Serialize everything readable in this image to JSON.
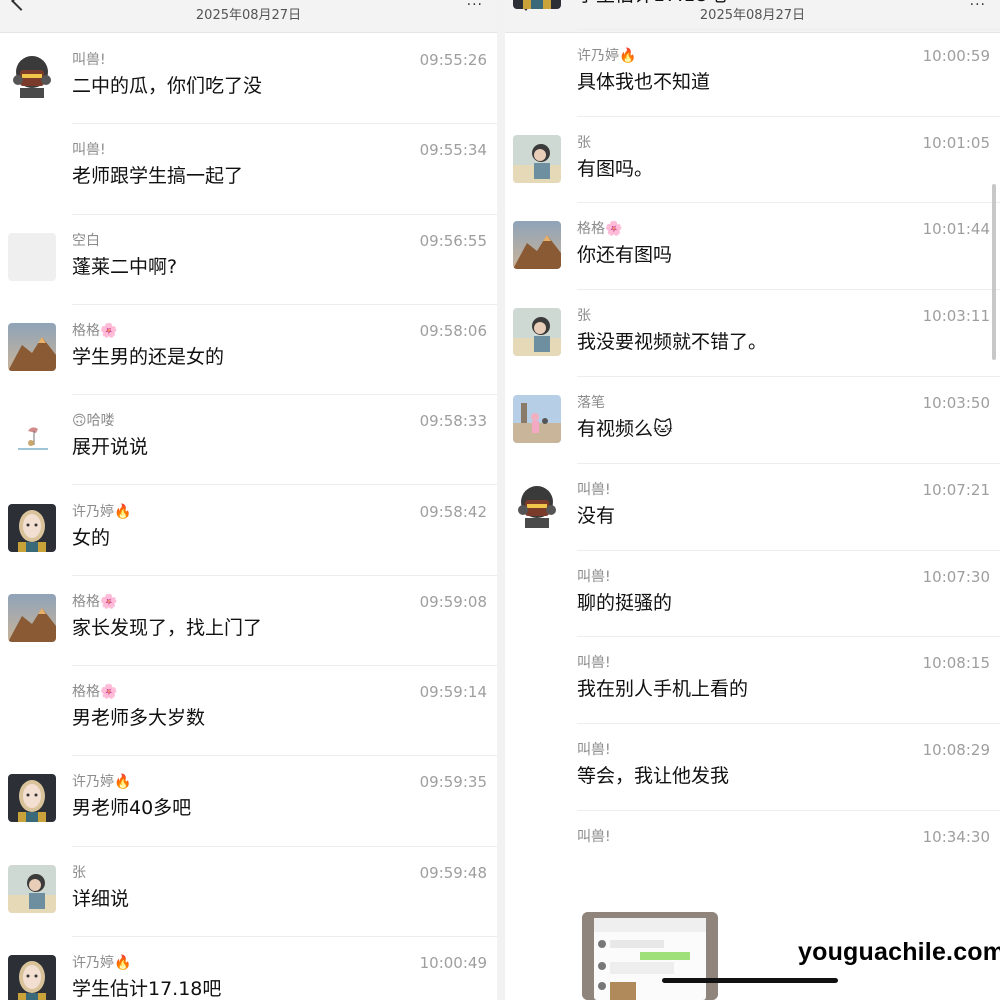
{
  "header": {
    "date": "2025年08月27日"
  },
  "left_messages": [
    {
      "name": "叫兽!",
      "time": "09:55:26",
      "text": "二中的瓜，你们吃了没",
      "avatar": "warrior-avatar"
    },
    {
      "name": "叫兽!",
      "time": "09:55:34",
      "text": "老师跟学生搞一起了",
      "avatar": ""
    },
    {
      "name": "空白",
      "time": "09:56:55",
      "text": "蓬莱二中啊?",
      "avatar": "blank-avatar"
    },
    {
      "name": "格格🌸",
      "time": "09:58:06",
      "text": "学生男的还是女的",
      "avatar": "mountain-avatar"
    },
    {
      "name": "🙃哈喽",
      "time": "09:58:33",
      "text": "展开说说",
      "avatar": "doodle-avatar"
    },
    {
      "name": "许乃婷🔥",
      "time": "09:58:42",
      "text": "女的",
      "avatar": "girl-avatar"
    },
    {
      "name": "格格🌸",
      "time": "09:59:08",
      "text": "家长发现了，找上门了",
      "avatar": "mountain-avatar"
    },
    {
      "name": "格格🌸",
      "time": "09:59:14",
      "text": "男老师多大岁数",
      "avatar": ""
    },
    {
      "name": "许乃婷🔥",
      "time": "09:59:35",
      "text": "男老师40多吧",
      "avatar": "girl-avatar"
    },
    {
      "name": "张",
      "time": "09:59:48",
      "text": "详细说",
      "avatar": "boy-avatar"
    },
    {
      "name": "许乃婷🔥",
      "time": "10:00:49",
      "text": "学生估计17.18吧",
      "avatar": "girl-avatar"
    }
  ],
  "right_messages": [
    {
      "name": "许乃婷🔥",
      "time": "10:00:49",
      "text": "学生估计17.18吧",
      "avatar": "girl-avatar"
    },
    {
      "name": "许乃婷🔥",
      "time": "10:00:59",
      "text": "具体我也不知道",
      "avatar": ""
    },
    {
      "name": "张",
      "time": "10:01:05",
      "text": "有图吗。",
      "avatar": "boy-avatar"
    },
    {
      "name": "格格🌸",
      "time": "10:01:44",
      "text": "你还有图吗",
      "avatar": "mountain-avatar"
    },
    {
      "name": "张",
      "time": "10:03:11",
      "text": "我没要视频就不错了。",
      "avatar": "boy-avatar"
    },
    {
      "name": "落笔",
      "time": "10:03:50",
      "text": "有视频么🐱",
      "avatar": "photo-avatar"
    },
    {
      "name": "叫兽!",
      "time": "10:07:21",
      "text": "没有",
      "avatar": "warrior-avatar"
    },
    {
      "name": "叫兽!",
      "time": "10:07:30",
      "text": "聊的挺骚的",
      "avatar": ""
    },
    {
      "name": "叫兽!",
      "time": "10:08:15",
      "text": "我在别人手机上看的",
      "avatar": ""
    },
    {
      "name": "叫兽!",
      "time": "10:08:29",
      "text": "等会，我让他发我",
      "avatar": ""
    },
    {
      "name": "叫兽!",
      "time": "10:34:30",
      "text": "",
      "avatar": ""
    }
  ],
  "watermark": "youguachile.com",
  "colors": {
    "name": "#8c8c8c",
    "time": "#9e9e9e",
    "text": "#111111",
    "divider": "#ededed"
  }
}
